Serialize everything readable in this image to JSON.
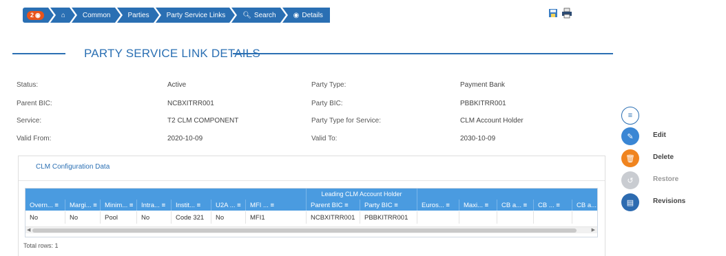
{
  "breadcrumb": {
    "badge_count": "2",
    "items": [
      "Common",
      "Parties",
      "Party Service Links",
      "Search",
      "Details"
    ]
  },
  "page_title": "PARTY SERVICE LINK DETAILS",
  "details": {
    "status_label": "Status:",
    "status_value": "Active",
    "party_type_label": "Party Type:",
    "party_type_value": "Payment Bank",
    "parent_bic_label": "Parent BIC:",
    "parent_bic_value": "NCBXITRR001",
    "party_bic_label": "Party BIC:",
    "party_bic_value": "PBBKITRR001",
    "service_label": "Service:",
    "service_value": "T2 CLM COMPONENT",
    "party_type_service_label": "Party Type for Service:",
    "party_type_service_value": "CLM Account Holder",
    "valid_from_label": "Valid From:",
    "valid_from_value": "2020-10-09",
    "valid_to_label": "Valid To:",
    "valid_to_value": "2030-10-09"
  },
  "actions": {
    "edit": "Edit",
    "delete": "Delete",
    "restore": "Restore",
    "revisions": "Revisions"
  },
  "clm_section": {
    "title": "CLM Configuration Data",
    "group_header": "Leading CLM Account Holder",
    "columns": [
      "Overn... ≡",
      "Margi... ≡",
      "Minim... ≡",
      "Intra... ≡",
      "Instit... ≡",
      "U2A ... ≡",
      "MFI ... ≡",
      "Parent BIC ≡",
      "Party BIC ≡",
      "Euros... ≡",
      "Maxi... ≡",
      "CB a... ≡",
      "CB ... ≡",
      "CB a..."
    ],
    "row": [
      "No",
      "No",
      "Pool",
      "No",
      "Code 321",
      "No",
      "MFI1",
      "NCBXITRR001",
      "PBBKITRR001",
      "",
      "",
      "",
      "",
      ""
    ],
    "total_rows": "Total rows: 1"
  },
  "colors": {
    "primary": "#2a6fb3",
    "table_header": "#4a9be0",
    "badge": "#e8541c",
    "delete": "#f0841f",
    "restore": "#c9ccd1",
    "revisions": "#2d6bb0"
  }
}
